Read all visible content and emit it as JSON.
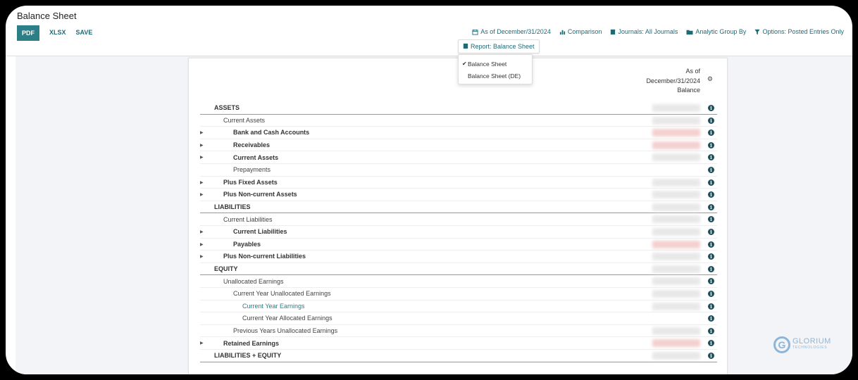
{
  "page": {
    "title": "Balance Sheet"
  },
  "toolbar": {
    "pdf": "PDF",
    "xlsx": "XLSX",
    "save": "SAVE"
  },
  "filters": {
    "date": "As of December/31/2024",
    "comparison": "Comparison",
    "journals": "Journals: All Journals",
    "analytic": "Analytic Group By",
    "options": "Options: Posted Entries Only"
  },
  "report_button": "Report: Balance Sheet",
  "report_menu": {
    "items": [
      "Balance Sheet",
      "Balance Sheet (DE)"
    ],
    "selected": "Balance Sheet"
  },
  "columns": {
    "line1": "As of",
    "line2": "December/31/2024",
    "line3": "Balance"
  },
  "rows": [
    {
      "label": "ASSETS",
      "level": 0,
      "bold": true,
      "section": true,
      "expand": false,
      "value": "blur"
    },
    {
      "label": "Current Assets",
      "level": 1,
      "bold": false,
      "section": false,
      "expand": false,
      "value": "blur"
    },
    {
      "label": "Bank and Cash Accounts",
      "level": 2,
      "bold": true,
      "section": false,
      "expand": true,
      "value": "neg"
    },
    {
      "label": "Receivables",
      "level": 2,
      "bold": true,
      "section": false,
      "expand": true,
      "value": "neg"
    },
    {
      "label": "Current Assets",
      "level": 2,
      "bold": true,
      "section": false,
      "expand": true,
      "value": "blur"
    },
    {
      "label": "Prepayments",
      "level": 2,
      "bold": false,
      "section": false,
      "expand": false,
      "value": "none"
    },
    {
      "label": "Plus Fixed Assets",
      "level": 1,
      "bold": true,
      "section": false,
      "expand": true,
      "value": "blur"
    },
    {
      "label": "Plus Non-current Assets",
      "level": 1,
      "bold": true,
      "section": false,
      "expand": true,
      "value": "blur"
    },
    {
      "label": "LIABILITIES",
      "level": 0,
      "bold": true,
      "section": true,
      "expand": false,
      "value": "blur"
    },
    {
      "label": "Current Liabilities",
      "level": 1,
      "bold": false,
      "section": false,
      "expand": false,
      "value": "blur"
    },
    {
      "label": "Current Liabilities",
      "level": 2,
      "bold": true,
      "section": false,
      "expand": true,
      "value": "blur"
    },
    {
      "label": "Payables",
      "level": 2,
      "bold": true,
      "section": false,
      "expand": true,
      "value": "neg"
    },
    {
      "label": "Plus Non-current Liabilities",
      "level": 1,
      "bold": true,
      "section": false,
      "expand": true,
      "value": "blur"
    },
    {
      "label": "EQUITY",
      "level": 0,
      "bold": true,
      "section": true,
      "expand": false,
      "value": "blur"
    },
    {
      "label": "Unallocated Earnings",
      "level": 1,
      "bold": false,
      "section": false,
      "expand": false,
      "value": "blur"
    },
    {
      "label": "Current Year Unallocated Earnings",
      "level": 2,
      "bold": false,
      "section": false,
      "expand": false,
      "value": "blur"
    },
    {
      "label": "Current Year Earnings",
      "level": 3,
      "bold": false,
      "section": false,
      "expand": false,
      "value": "blur",
      "link": true
    },
    {
      "label": "Current Year Allocated Earnings",
      "level": 3,
      "bold": false,
      "section": false,
      "expand": false,
      "value": "none"
    },
    {
      "label": "Previous Years Unallocated Earnings",
      "level": 2,
      "bold": false,
      "section": false,
      "expand": false,
      "value": "blur"
    },
    {
      "label": "Retained Earnings",
      "level": 1,
      "bold": true,
      "section": false,
      "expand": true,
      "value": "neg"
    },
    {
      "label": "LIABILITIES + EQUITY",
      "level": 0,
      "bold": true,
      "section": true,
      "expand": false,
      "value": "blur"
    }
  ],
  "logo": {
    "name": "GLORIUM",
    "tagline": "TECHNOLOGIES",
    "mark": "G"
  },
  "colors": {
    "accent": "#2c7e87",
    "info": "#1f4f5a"
  }
}
